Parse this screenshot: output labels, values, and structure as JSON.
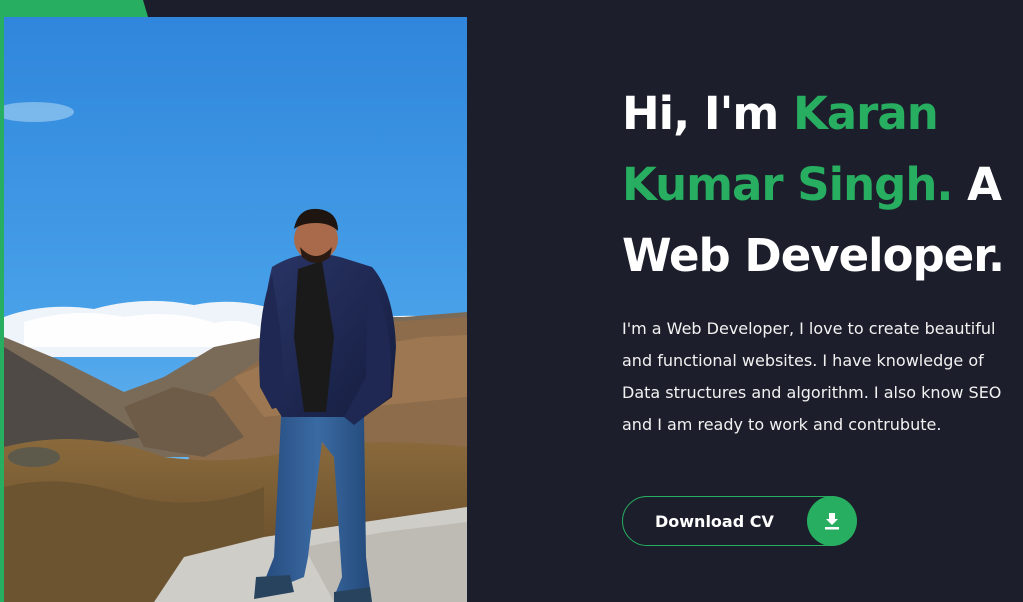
{
  "colors": {
    "accent": "#27ae60",
    "background": "#1c1f2b",
    "text": "#ffffff"
  },
  "hero": {
    "headline": {
      "prefix": "Hi, I'm ",
      "name": "Karan Kumar Singh.",
      "suffix": " A Web Developer."
    },
    "bio": "I'm a Web Developer, I love to create beautiful and functional websites. I have knowledge of Data structures and algorithm. I also know SEO and I am ready to work and contrubute.",
    "download_button": {
      "label": "Download CV",
      "icon": "download-icon"
    },
    "photo": {
      "icon": "profile-photo"
    }
  }
}
